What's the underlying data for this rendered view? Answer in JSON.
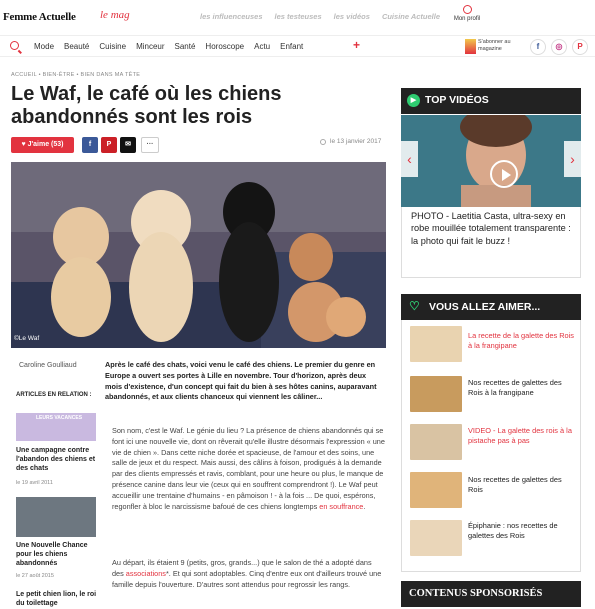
{
  "header": {
    "logo": "Femme Actuelle",
    "lemag": "le mag",
    "links": [
      "les influenceuses",
      "les testeuses",
      "les vidéos",
      "Cuisine Actuelle"
    ],
    "profile": "Mon profil"
  },
  "nav": {
    "items": [
      "Mode",
      "Beauté",
      "Cuisine",
      "Minceur",
      "Santé",
      "Horoscope",
      "Actu",
      "Enfant"
    ],
    "plus": "+",
    "subscribe": "S'abonner au magazine",
    "social": [
      "f",
      "◎",
      "P"
    ]
  },
  "article": {
    "breadcrumb": "ACCUEIL  •  BIEN-ÊTRE  •  BIEN DANS MA TÊTE",
    "title": "Le Waf, le café où les chiens abandonnés sont les rois",
    "date": "le 13 janvier 2017",
    "like_label": "♥ J'aime (53)",
    "share_more": "···",
    "image_credit": "©Le Waf",
    "author": "Caroline Goulliaud",
    "chapo": "Après le café des chats, voici venu le café des chiens. Le premier du genre en Europe a ouvert ses portes à Lille en novembre. Tour d'horizon, après deux mois d'existence, d'un concept qui fait du bien à ses hôtes canins, auparavant abandonnés, et aux clients chanceux qui viennent les câliner...",
    "p1": "Son nom, c'est le Waf. Le génie du lieu ? La présence de chiens abandonnés qui se font ici une nouvelle vie, dont on rêverait qu'elle illustre désormais l'expression « une vie de chien ». Dans cette niche dorée et spacieuse, de l'amour et des soins, une salle de jeux et du respect. Mais aussi, des câlins à foison, prodigués à la demande par des clients empressés et ravis, comblant, pour une heure ou plus, le manque de présence canine dans leur vie (ceux qui en souffrent comprendront !). Le Waf peut accueillir une trentaine d'humains - en pâmoison ! - à la fois ... De quoi, espérons, regonfler à bloc le narcissisme bafoué de ces chiens longtemps",
    "p1_link": "en souffrance",
    "p2_a": "Au départ, ils étaient 9 (petits, gros, grands...) que le salon de thé a adopté dans des",
    "p2_link": "associations",
    "p2_b": "*. Et qui sont adoptables. Cinq d'entre eux ont d'ailleurs trouvé une famille depuis l'ouverture. D'autres sont attendus pour regrossir les rangs."
  },
  "related": {
    "heading": "ARTICLES EN RELATION :",
    "items": [
      {
        "title": "Une campagne contre l'abandon des chiens et des chats",
        "date": "le 19 avril 2011",
        "img_label": "LEURS VACANCES"
      },
      {
        "title": "Une Nouvelle Chance pour les chiens abandonnés",
        "date": "le 27 août 2015"
      },
      {
        "title": "Le petit chien lion, le roi du toilettage"
      }
    ]
  },
  "sidebar": {
    "top_videos": "TOP VIDÉOS",
    "video_caption": "PHOTO - Laetitia Casta, ultra-sexy en robe mouillée totalement transparente : la photo qui fait le buzz !",
    "aimer_title": "VOUS ALLEZ AIMER...",
    "aimer": [
      {
        "title": "La recette de la galette des Rois à la frangipane",
        "color": "#e2333f"
      },
      {
        "title": "Nos recettes de galettes des Rois à la frangipane",
        "color": "#222222"
      },
      {
        "title": "VIDEO - La galette des rois à la pistache pas à pas",
        "color": "#e2333f"
      },
      {
        "title": "Nos recettes de galettes des Rois",
        "color": "#222222"
      },
      {
        "title": "Épiphanie : nos recettes de galettes des Rois",
        "color": "#222222"
      }
    ],
    "sponsored": "CONTENUS SPONSORISÉS"
  },
  "colors": {
    "brand": "#e2333f",
    "dark": "#222222",
    "green": "#2ecc71"
  }
}
